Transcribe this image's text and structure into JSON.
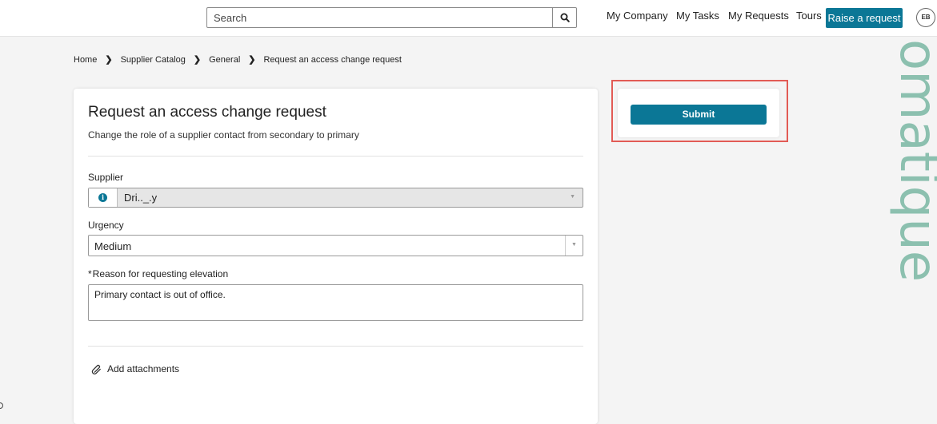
{
  "header": {
    "search": {
      "placeholder": "Search",
      "value": ""
    },
    "nav": [
      "My Company",
      "My Tasks",
      "My Requests",
      "Tours"
    ],
    "raise_request_label": "Raise a request",
    "avatar_initials": "EB",
    "watermark_text": "omatique",
    "accent_color": "#0b7796"
  },
  "breadcrumb": [
    "Home",
    "Supplier Catalog",
    "General",
    "Request an access change request"
  ],
  "form": {
    "title": "Request an access change request",
    "subtitle": "Change the role of a supplier contact from secondary to primary",
    "supplier": {
      "label": "Supplier",
      "value": "Dri.._.y"
    },
    "urgency": {
      "label": "Urgency",
      "value": "Medium"
    },
    "reason": {
      "required_mark": "*",
      "label": "Reason for requesting elevation",
      "value": "Primary contact is out of office."
    },
    "attachments_label": "Add attachments"
  },
  "actions": {
    "submit_label": "Submit",
    "highlight_color": "#e25b55"
  }
}
